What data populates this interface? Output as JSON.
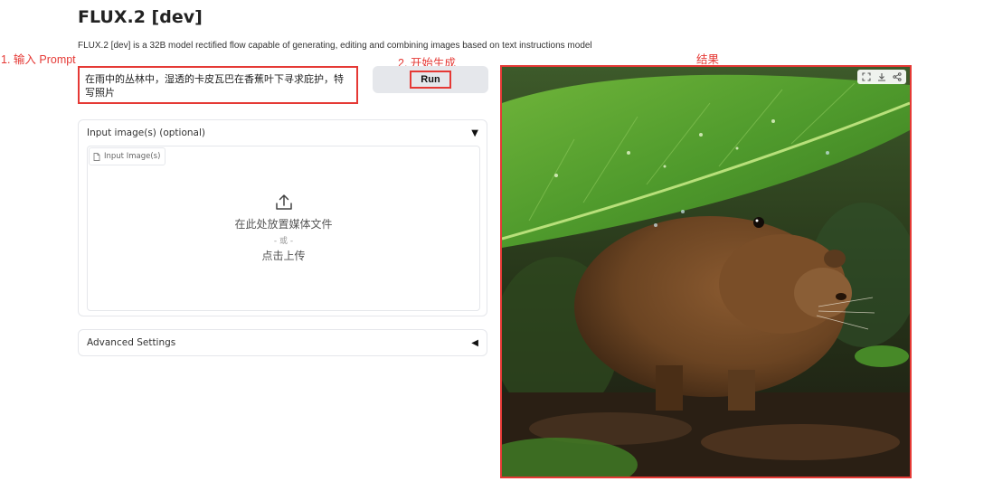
{
  "app": {
    "title": "FLUX.2 [dev]",
    "description": "FLUX.2 [dev] is a 32B model rectified flow capable of generating, editing and combining images based on text instructions model"
  },
  "annotations": {
    "step1": "1. 输入 Prompt",
    "step2": "2. 开始生成",
    "result": "结果"
  },
  "prompt": {
    "value": "在雨中的丛林中，湿透的卡皮瓦巴在香蕉叶下寻求庇护，特写照片"
  },
  "run_button": {
    "label": "Run"
  },
  "input_images": {
    "header": "Input image(s) (optional)",
    "chip_label": "Input Image(s)",
    "drop_text": "在此处放置媒体文件",
    "or_text": "- 或 -",
    "click_text": "点击上传"
  },
  "advanced": {
    "label": "Advanced Settings"
  },
  "colors": {
    "annotation": "#e53935",
    "leaf": "#4f9a2c",
    "capybara": "#6b4422"
  }
}
